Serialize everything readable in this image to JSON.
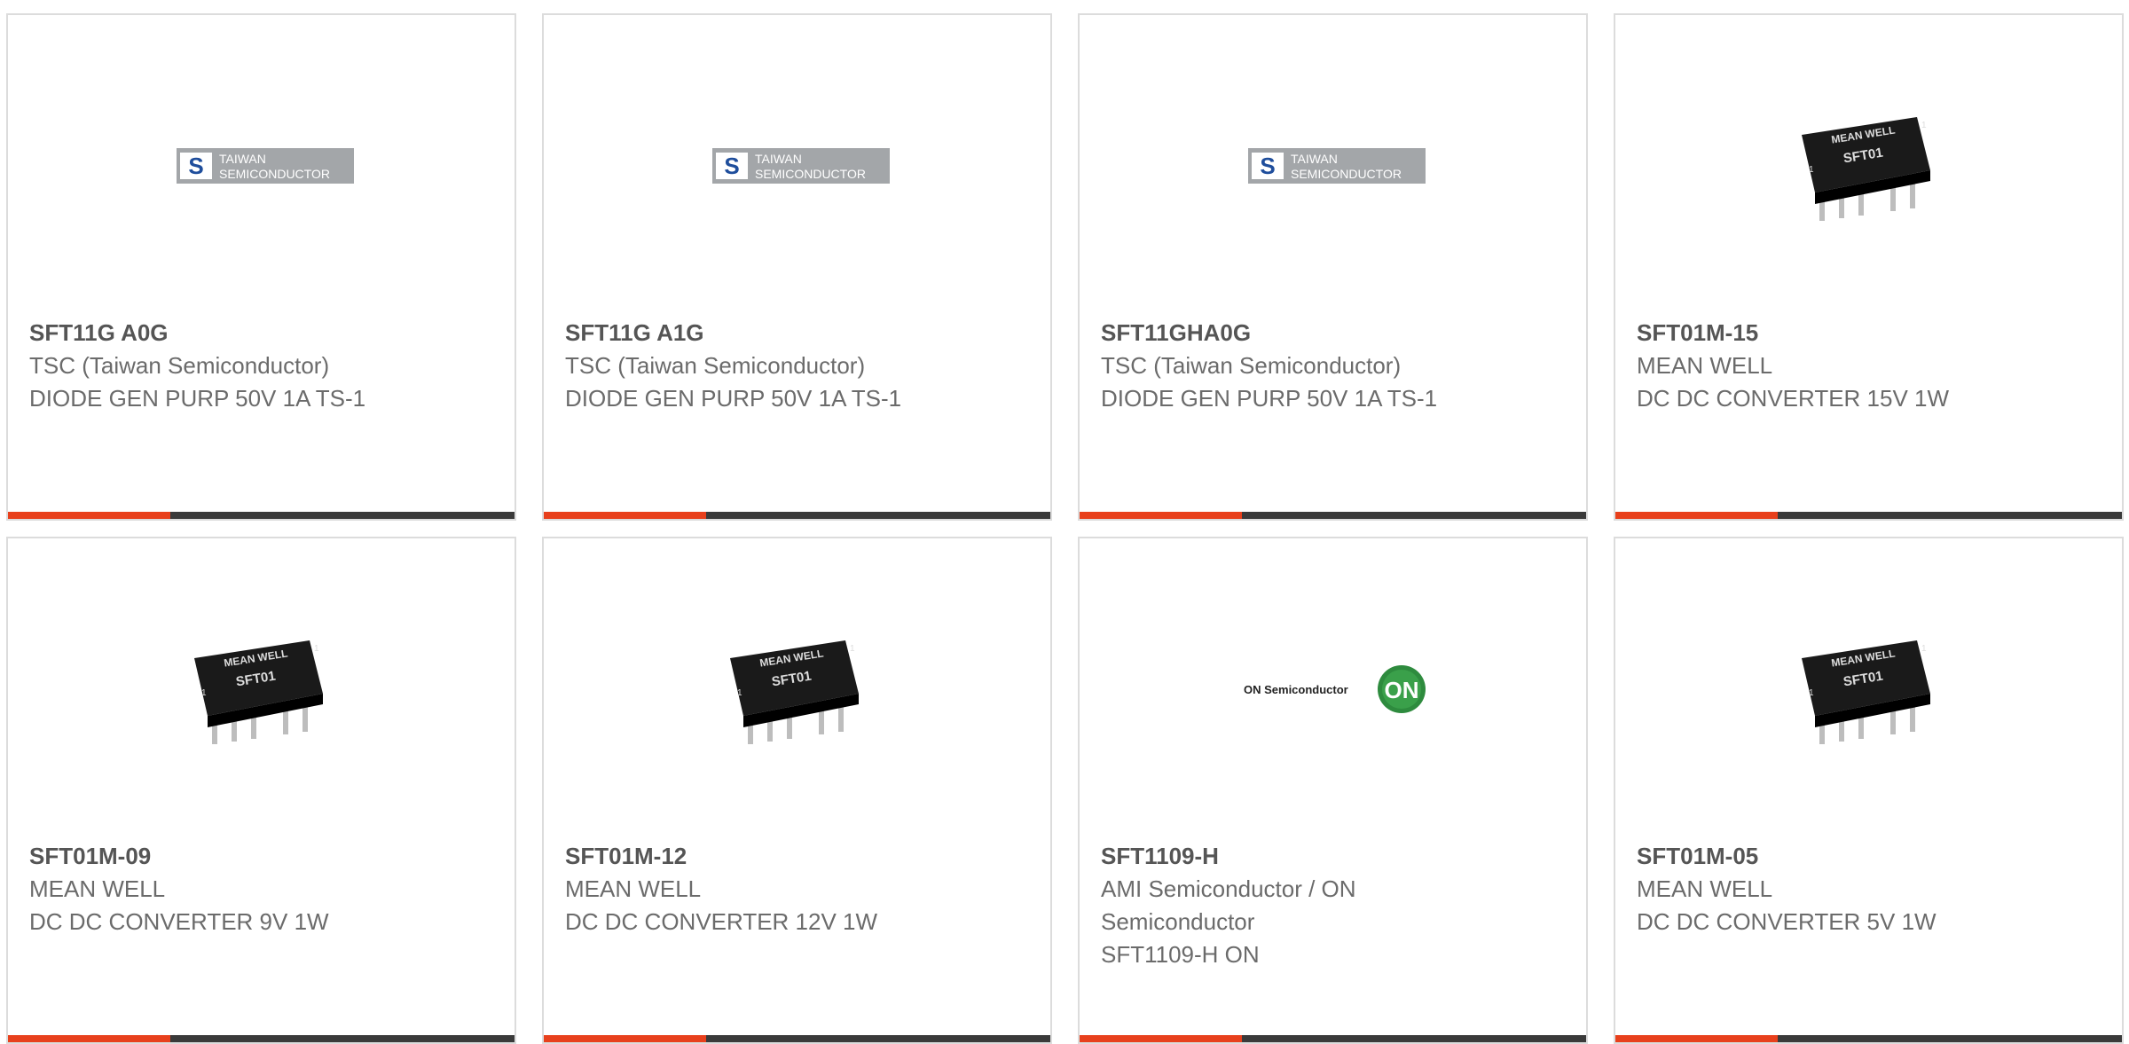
{
  "colors": {
    "accent": "#e8401c",
    "bar": "#3a3a3a",
    "text": "#6b6b6b",
    "part_number": "#555555",
    "border": "#dcdcdc"
  },
  "logos": {
    "tsc_line1": "TAIWAN",
    "tsc_line2": "SEMICONDUCTOR",
    "on_text": "ON Semiconductor",
    "on_badge": "ON"
  },
  "chip_marking": {
    "brand": "MEAN WELL",
    "model": "SFT01",
    "pin1": "1"
  },
  "products": [
    {
      "part_number": "SFT11G A0G",
      "manufacturer": "TSC (Taiwan Semiconductor)",
      "description": "DIODE GEN PURP 50V 1A TS-1",
      "image": "tsc-logo"
    },
    {
      "part_number": "SFT11G A1G",
      "manufacturer": "TSC (Taiwan Semiconductor)",
      "description": "DIODE GEN PURP 50V 1A TS-1",
      "image": "tsc-logo"
    },
    {
      "part_number": "SFT11GHA0G",
      "manufacturer": "TSC (Taiwan Semiconductor)",
      "description": "DIODE GEN PURP 50V 1A TS-1",
      "image": "tsc-logo"
    },
    {
      "part_number": "SFT01M-15",
      "manufacturer": "MEAN WELL",
      "description": "DC DC CONVERTER 15V 1W",
      "image": "meanwell-chip"
    },
    {
      "part_number": "SFT01M-09",
      "manufacturer": "MEAN WELL",
      "description": "DC DC CONVERTER 9V 1W",
      "image": "meanwell-chip"
    },
    {
      "part_number": "SFT01M-12",
      "manufacturer": "MEAN WELL",
      "description": "DC DC CONVERTER 12V 1W",
      "image": "meanwell-chip"
    },
    {
      "part_number": "SFT1109-H",
      "manufacturer": "AMI Semiconductor / ON Semiconductor",
      "description": "SFT1109-H ON",
      "image": "on-logo"
    },
    {
      "part_number": "SFT01M-05",
      "manufacturer": "MEAN WELL",
      "description": "DC DC CONVERTER 5V 1W",
      "image": "meanwell-chip"
    }
  ]
}
